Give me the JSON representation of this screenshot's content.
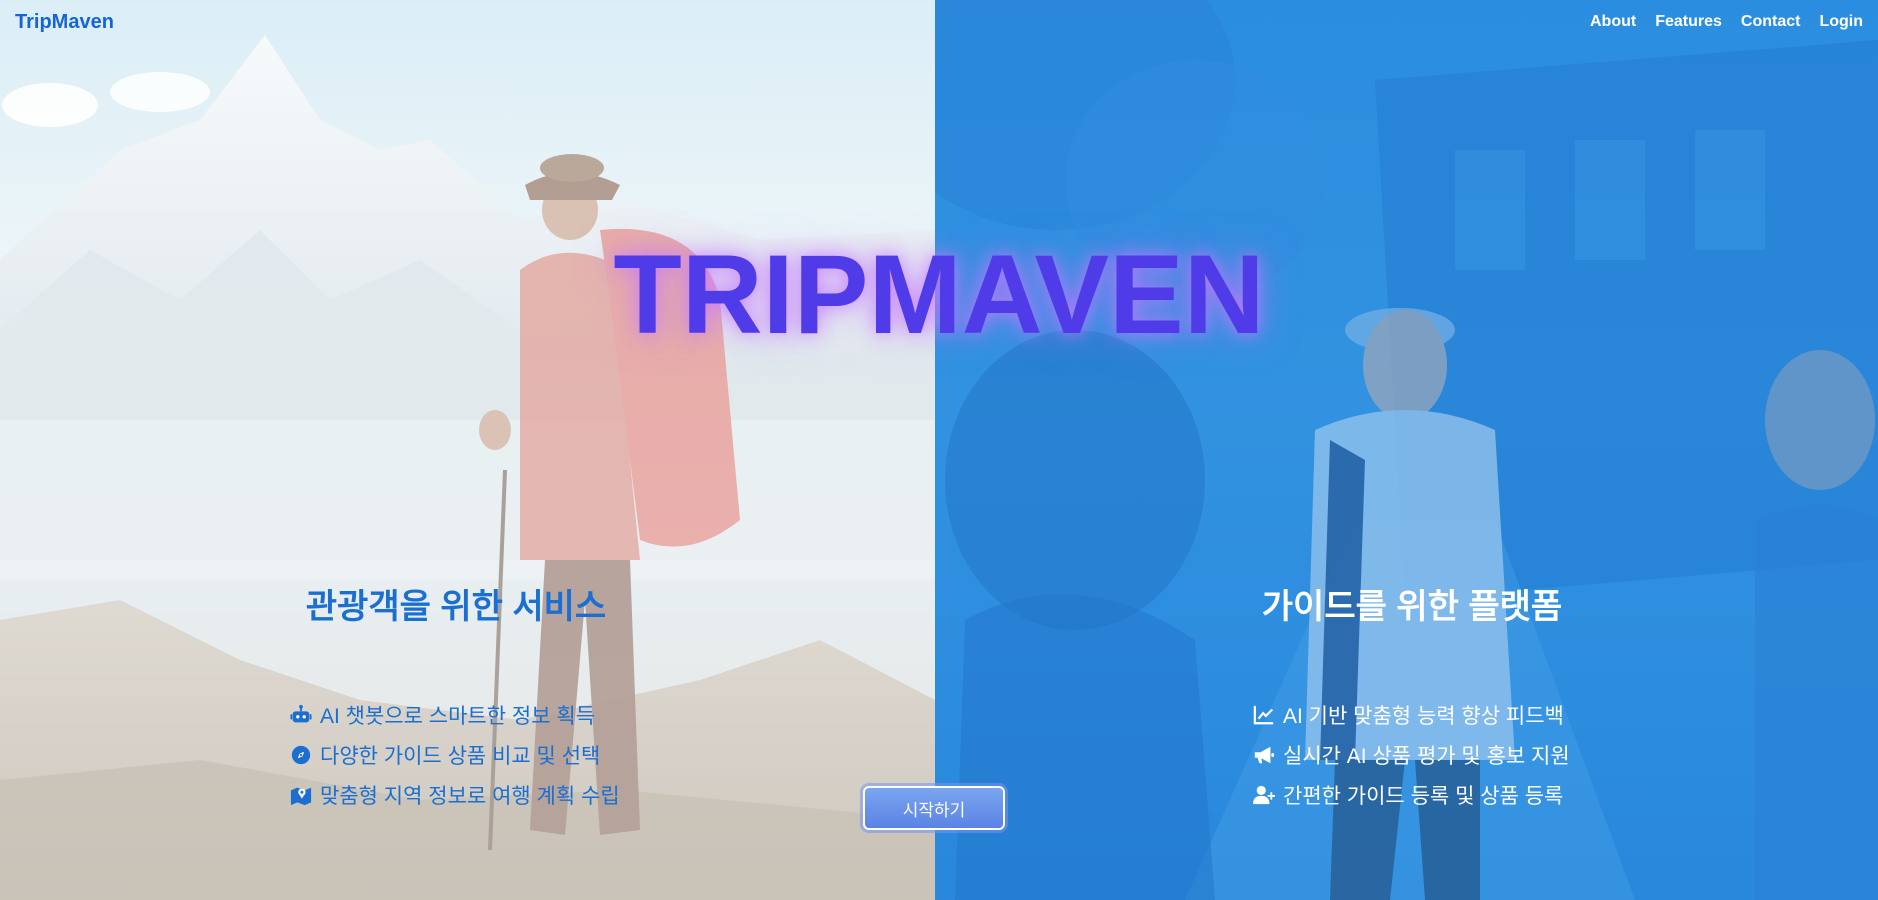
{
  "nav": {
    "brand": "TripMaven",
    "links": [
      "About",
      "Features",
      "Contact",
      "Login"
    ]
  },
  "hero": {
    "title": "TRIPMAVEN"
  },
  "tourist": {
    "heading": "관광객을 위한 서비스",
    "features": [
      {
        "icon": "robot-icon",
        "text": "AI 챗봇으로 스마트한 정보 획득"
      },
      {
        "icon": "compass-icon",
        "text": "다양한 가이드 상품 비교 및 선택"
      },
      {
        "icon": "map-location-icon",
        "text": "맞춤형 지역 정보로 여행 계획 수립"
      }
    ]
  },
  "guide": {
    "heading": "가이드를 위한 플랫폼",
    "features": [
      {
        "icon": "chart-line-icon",
        "text": "AI 기반 맞춤형 능력 향상 피드백"
      },
      {
        "icon": "bullhorn-icon",
        "text": "실시간 AI 상품 평가 및 홍보 지원"
      },
      {
        "icon": "user-plus-icon",
        "text": "간편한 가이드 등록 및 상품 등록"
      }
    ]
  },
  "cta": {
    "label": "시작하기"
  },
  "colors": {
    "brand": "#1565d8",
    "title": "#4f3ce8",
    "tourist_text": "#1a6fd0",
    "guide_panel": "#2f8fde",
    "button": "#6a94ea"
  }
}
